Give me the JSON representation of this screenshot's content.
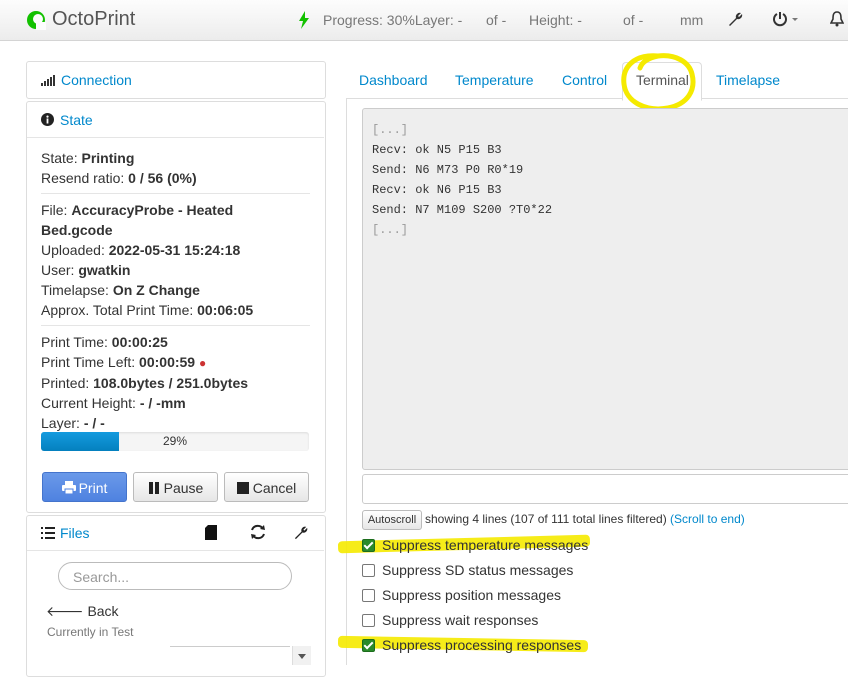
{
  "navbar": {
    "brand": "OctoPrint",
    "progress_label": "Progress: 30%",
    "layer_label": "Layer: -",
    "of1": "of -",
    "height_label": "Height: -",
    "of2": "of -",
    "unit": "mm"
  },
  "connection": {
    "title": "Connection"
  },
  "state": {
    "title": "State",
    "state_label": "State:",
    "state_value": "Printing",
    "resend_label": "Resend ratio:",
    "resend_value": "0 / 56 (0%)",
    "file_label": "File:",
    "file_value_1": "AccuracyProbe - Heated",
    "file_value_2": "Bed.gcode",
    "uploaded_label": "Uploaded:",
    "uploaded_value": "2022-05-31 15:24:18",
    "user_label": "User:",
    "user_value": "gwatkin",
    "timelapse_label": "Timelapse:",
    "timelapse_value": "On Z Change",
    "approx_label": "Approx. Total Print Time:",
    "approx_value": "00:06:05",
    "print_time_label": "Print Time:",
    "print_time_value": "00:00:25",
    "time_left_label": "Print Time Left:",
    "time_left_value": "00:00:59",
    "printed_label": "Printed:",
    "printed_value": "108.0bytes / 251.0bytes",
    "height_label": "Current Height:",
    "height_value": "- / -mm",
    "layer_label": "Layer:",
    "layer_value": "- / -",
    "progress_text": "29%",
    "progress_value": 0.29
  },
  "buttons": {
    "print": "Print",
    "pause": "Pause",
    "cancel": "Cancel"
  },
  "files": {
    "title": "Files",
    "search_placeholder": "Search...",
    "back": "Back",
    "current_folder": "Currently in Test"
  },
  "tabs": [
    "Dashboard",
    "Temperature",
    "Control",
    "Terminal",
    "Timelapse"
  ],
  "terminal": {
    "lines": [
      "[...]",
      "Recv: ok N5 P15 B3",
      "Send: N6 M73 P0 R0*19",
      "Recv: ok N6 P15 B3",
      "Send: N7 M109 S200 ?T0*22",
      "[...]"
    ],
    "autoscroll": "Autoscroll",
    "filter_info": "showing 4 lines (107 of 111 total lines filtered)",
    "scroll_to_end": "(Scroll to end)"
  },
  "filters": [
    {
      "label": "Suppress temperature messages",
      "checked": true
    },
    {
      "label": "Suppress SD status messages",
      "checked": false
    },
    {
      "label": "Suppress position messages",
      "checked": false
    },
    {
      "label": "Suppress wait responses",
      "checked": false
    },
    {
      "label": "Suppress processing responses",
      "checked": true
    }
  ],
  "colors": {
    "link": "#0088cc",
    "primary_button": "#4f82e0",
    "highlight": "#f5ea00",
    "progress": "#0480be"
  }
}
